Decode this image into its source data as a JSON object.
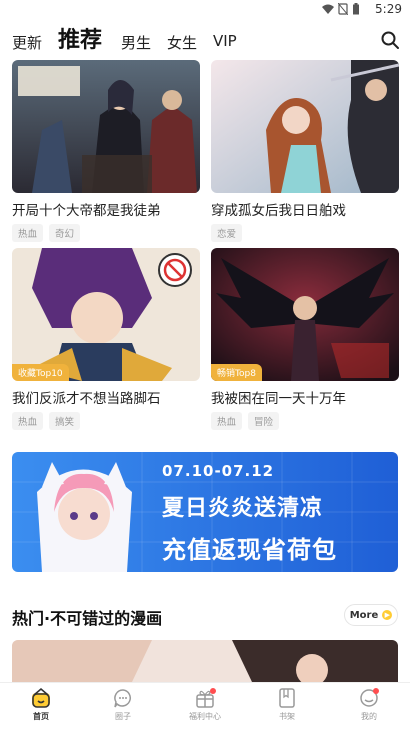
{
  "status_bar": {
    "time": "5:29"
  },
  "top_nav": {
    "tabs": [
      {
        "label": "更新"
      },
      {
        "label": "推荐"
      },
      {
        "label": "男生"
      },
      {
        "label": "女生"
      },
      {
        "label": "VIP"
      }
    ],
    "active_tab": "推荐"
  },
  "cards": [
    {
      "title": "开局十个大帝都是我徒弟",
      "tags": [
        "热血",
        "奇幻"
      ],
      "badge": ""
    },
    {
      "title": "穿成孤女后我日日舶戏",
      "tags": [
        "恋爱"
      ],
      "badge": ""
    },
    {
      "title": "我们反派才不想当路脚石",
      "tags": [
        "热血",
        "搞笑"
      ],
      "badge": "收藏Top10"
    },
    {
      "title": "我被困在同一天十万年",
      "tags": [
        "热血",
        "冒险"
      ],
      "badge": "畅销Top8"
    }
  ],
  "banner": {
    "date": "07.10-07.12",
    "line1": "夏日炎炎送清凉",
    "line2": "充值返现省荷包"
  },
  "section": {
    "title": "热门·不可错过的漫画",
    "more_label": "More"
  },
  "bottom_nav": {
    "items": [
      {
        "label": "首页",
        "icon": "home-icon"
      },
      {
        "label": "圈子",
        "icon": "chat-icon"
      },
      {
        "label": "福利中心",
        "icon": "gift-icon"
      },
      {
        "label": "书架",
        "icon": "bookshelf-icon"
      },
      {
        "label": "我的",
        "icon": "profile-icon"
      }
    ],
    "active": "首页"
  },
  "colors": {
    "accent": "#ffcc33",
    "badge": "#f0b23c",
    "banner_blue": "#1f6fe0",
    "notification": "#ff4d4f"
  }
}
